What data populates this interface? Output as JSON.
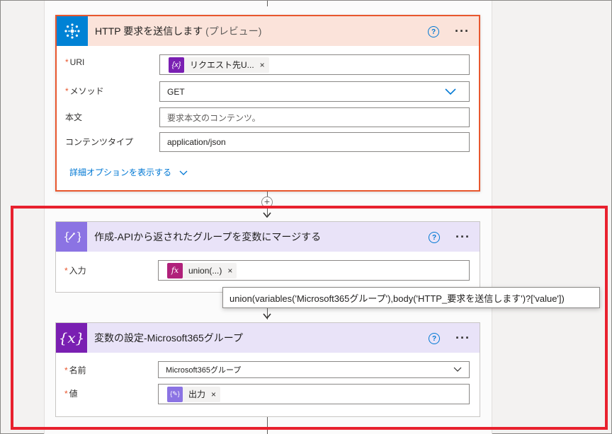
{
  "http_card": {
    "title": "HTTP 要求を送信します",
    "title_suffix": "(プレビュー)",
    "icon": "http-globe-icon",
    "header_color": "#fbe3da",
    "icon_bg": "#0082d5",
    "fields": {
      "uri_label": "URI",
      "uri_token": "リクエスト先U...",
      "method_label": "メソッド",
      "method_value": "GET",
      "body_label": "本文",
      "body_placeholder": "要求本文のコンテンツ。",
      "content_type_label": "コンテンツタイプ",
      "content_type_value": "application/json"
    },
    "advanced_link": "詳細オプションを表示する"
  },
  "compose_card": {
    "title": "作成-APIから返されたグループを変数にマージする",
    "icon": "compose-icon",
    "header_color": "#e9e3f8",
    "icon_bg": "#8b73e3",
    "input_label": "入力",
    "token": "union(...)",
    "token_icon": "fx"
  },
  "tooltip": {
    "text": "union(variables('Microsoft365グループ'),body('HTTP_要求を送信します')?['value'])"
  },
  "setvar_card": {
    "title": "変数の設定-Microsoft365グループ",
    "icon": "variable-icon",
    "header_color": "#e9e3f8",
    "icon_bg": "#7a1fb2",
    "name_label": "名前",
    "name_value": "Microsoft365グループ",
    "value_label": "値",
    "value_token": "出力"
  },
  "colors": {
    "accent": "#0078d4",
    "required": "#e8572e",
    "highlight_frame": "#e8212e"
  },
  "required_mark": "*",
  "help_glyph": "?",
  "more_glyph": "···",
  "remove_glyph": "×"
}
